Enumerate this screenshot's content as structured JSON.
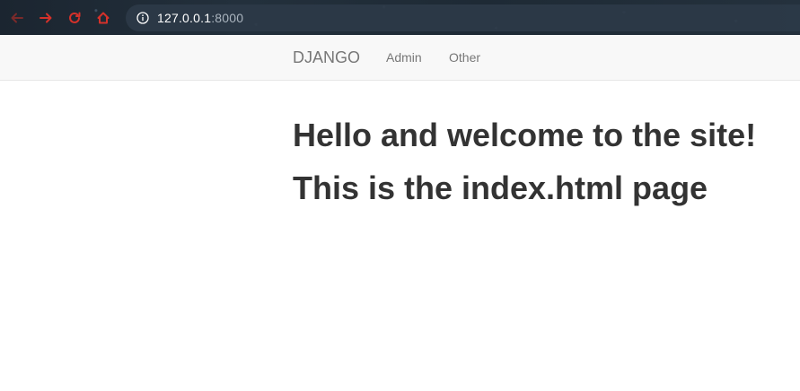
{
  "browser": {
    "url_host": "127.0.0.1",
    "url_port": ":8000",
    "nav_icon_color": "#c0392b"
  },
  "navbar": {
    "brand": "DJANGO",
    "links": [
      {
        "label": "Admin"
      },
      {
        "label": "Other"
      }
    ]
  },
  "main": {
    "heading": "Hello and welcome to the site!",
    "subheading": "This is the index.html page"
  }
}
